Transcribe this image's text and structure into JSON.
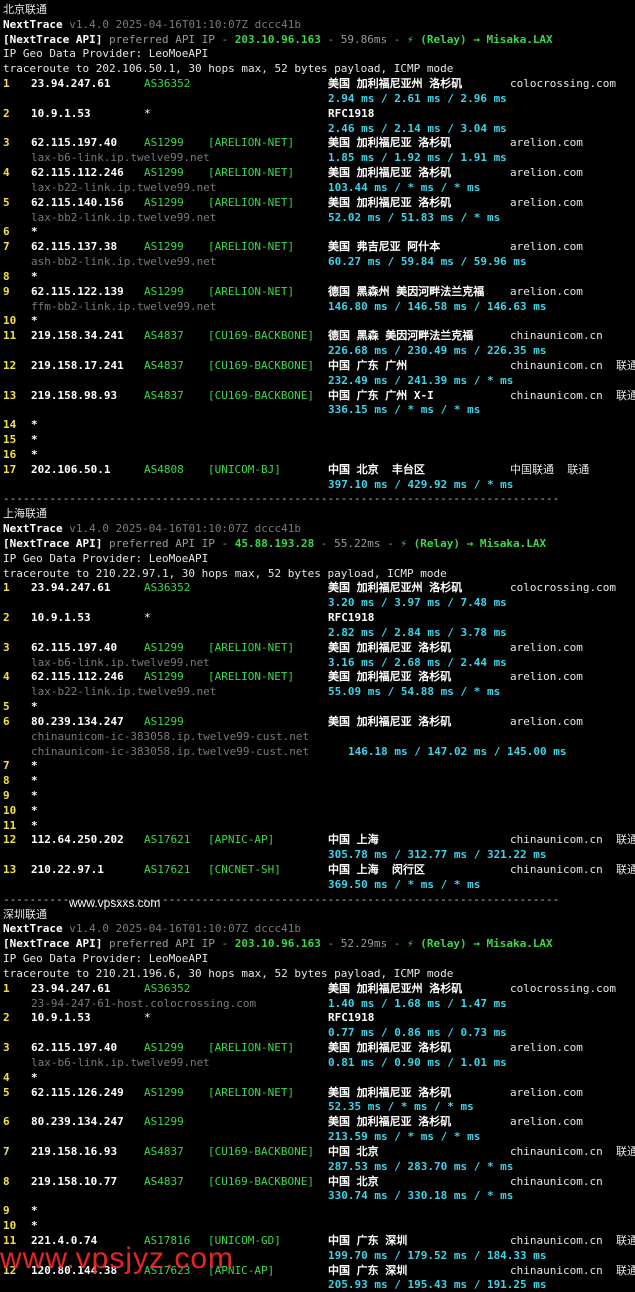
{
  "blocks": [
    {
      "title": "北京联通",
      "version_line": {
        "prog": "NextTrace",
        "ver": "v1.4.0 2025-04-16T01:10:07Z dccc41b"
      },
      "api_line": {
        "tag": "[NextTrace API]",
        "text": " preferred API IP - ",
        "ip": "203.10.96.163",
        "ms": " - 59.86ms - ",
        "relay": "⚡ (Relay) → Misaka.LAX"
      },
      "geo_line": "IP Geo Data Provider: LeoMoeAPI",
      "trace_line": "traceroute to 202.106.50.1, 30 hops max, 52 bytes payload, ICMP mode",
      "hops": [
        {
          "n": "1",
          "ip": "23.94.247.61",
          "as": "AS36352",
          "tag": "",
          "geo": "美国 加利福尼亚州 洛杉矶",
          "dom": "colocrossing.com",
          "rtt": "2.94 ms / 2.61 ms / 2.96 ms"
        },
        {
          "n": "2",
          "ip": "10.9.1.53",
          "as": "*",
          "tag": "",
          "geo": "RFC1918",
          "dom": "",
          "rtt": "2.46 ms / 2.14 ms / 3.04 ms"
        },
        {
          "n": "3",
          "ip": "62.115.197.40",
          "as": "AS1299",
          "tag": "[ARELION-NET]",
          "geo": "美国 加利福尼亚 洛杉矶",
          "dom": "arelion.com",
          "host": "lax-b6-link.ip.twelve99.net",
          "rtt": "1.85 ms / 1.92 ms / 1.91 ms"
        },
        {
          "n": "4",
          "ip": "62.115.112.246",
          "as": "AS1299",
          "tag": "[ARELION-NET]",
          "geo": "美国 加利福尼亚 洛杉矶",
          "dom": "arelion.com",
          "host": "lax-b22-link.ip.twelve99.net",
          "rtt": "103.44 ms / * ms / * ms"
        },
        {
          "n": "5",
          "ip": "62.115.140.156",
          "as": "AS1299",
          "tag": "[ARELION-NET]",
          "geo": "美国 加利福尼亚 洛杉矶",
          "dom": "arelion.com",
          "host": "lax-bb2-link.ip.twelve99.net",
          "rtt": "52.02 ms / 51.83 ms / * ms"
        },
        {
          "n": "6",
          "star": true
        },
        {
          "n": "7",
          "ip": "62.115.137.38",
          "as": "AS1299",
          "tag": "[ARELION-NET]",
          "geo": "美国 弗吉尼亚 阿什本",
          "dom": "arelion.com",
          "host": "ash-bb2-link.ip.twelve99.net",
          "rtt": "60.27 ms / 59.84 ms / 59.96 ms"
        },
        {
          "n": "8",
          "star": true
        },
        {
          "n": "9",
          "ip": "62.115.122.139",
          "as": "AS1299",
          "tag": "[ARELION-NET]",
          "geo": "德国 黑森州 美因河畔法兰克福",
          "dom": "arelion.com",
          "host": "ffm-bb2-link.ip.twelve99.net",
          "rtt": "146.80 ms / 146.58 ms / 146.63 ms"
        },
        {
          "n": "10",
          "star": true
        },
        {
          "n": "11",
          "ip": "219.158.34.241",
          "as": "AS4837",
          "tag": "[CU169-BACKBONE]",
          "geo": "德国 黑森 美因河畔法兰克福",
          "dom": "chinaunicom.cn",
          "rtt": "226.68 ms / 230.49 ms / 226.35 ms"
        },
        {
          "n": "12",
          "ip": "219.158.17.241",
          "as": "AS4837",
          "tag": "[CU169-BACKBONE]",
          "geo": "中国 广东 广州",
          "dom": "chinaunicom.cn  联通",
          "rtt": "232.49 ms / 241.39 ms / * ms"
        },
        {
          "n": "13",
          "ip": "219.158.98.93",
          "as": "AS4837",
          "tag": "[CU169-BACKBONE]",
          "geo": "中国 广东 广州 X-I",
          "dom": "chinaunicom.cn  联通",
          "rtt": "336.15 ms / * ms / * ms"
        },
        {
          "n": "14",
          "star": true
        },
        {
          "n": "15",
          "star": true
        },
        {
          "n": "16",
          "star": true
        },
        {
          "n": "17",
          "ip": "202.106.50.1",
          "as": "AS4808",
          "tag": "[UNICOM-BJ]",
          "geo": "中国 北京  丰台区",
          "dom": "中国联通  联通",
          "rtt": "397.10 ms / 429.92 ms / * ms"
        }
      ]
    },
    {
      "title": "上海联通",
      "version_line": {
        "prog": "NextTrace",
        "ver": "v1.4.0 2025-04-16T01:10:07Z dccc41b"
      },
      "api_line": {
        "tag": "[NextTrace API]",
        "text": " preferred API IP - ",
        "ip": "45.88.193.28",
        "ms": " - 55.22ms - ",
        "relay": "⚡ (Relay) → Misaka.LAX"
      },
      "geo_line": "IP Geo Data Provider: LeoMoeAPI",
      "trace_line": "traceroute to 210.22.97.1, 30 hops max, 52 bytes payload, ICMP mode",
      "hops": [
        {
          "n": "1",
          "ip": "23.94.247.61",
          "as": "AS36352",
          "tag": "",
          "geo": "美国 加利福尼亚州 洛杉矶",
          "dom": "colocrossing.com",
          "rtt": "3.20 ms / 3.97 ms / 7.48 ms"
        },
        {
          "n": "2",
          "ip": "10.9.1.53",
          "as": "*",
          "tag": "",
          "geo": "RFC1918",
          "dom": "",
          "rtt": "2.82 ms / 2.84 ms / 3.78 ms"
        },
        {
          "n": "3",
          "ip": "62.115.197.40",
          "as": "AS1299",
          "tag": "[ARELION-NET]",
          "geo": "美国 加利福尼亚 洛杉矶",
          "dom": "arelion.com",
          "host": "lax-b6-link.ip.twelve99.net",
          "rtt": "3.16 ms / 2.68 ms / 2.44 ms"
        },
        {
          "n": "4",
          "ip": "62.115.112.246",
          "as": "AS1299",
          "tag": "[ARELION-NET]",
          "geo": "美国 加利福尼亚 洛杉矶",
          "dom": "arelion.com",
          "host": "lax-b22-link.ip.twelve99.net",
          "rtt": "55.09 ms / 54.88 ms / * ms"
        },
        {
          "n": "5",
          "star": true
        },
        {
          "n": "6",
          "ip": "80.239.134.247",
          "as": "AS1299",
          "tag": "",
          "geo": "美国 加利福尼亚 洛杉矶",
          "dom": "arelion.com",
          "host": "chinaunicom-ic-383058.ip.twelve99-cust.net",
          "rtt_inline": "146.18 ms / 147.02 ms / 145.00 ms"
        },
        {
          "n": "7",
          "star": true
        },
        {
          "n": "8",
          "star": true
        },
        {
          "n": "9",
          "star": true
        },
        {
          "n": "10",
          "star": true
        },
        {
          "n": "11",
          "star": true
        },
        {
          "n": "12",
          "ip": "112.64.250.202",
          "as": "AS17621",
          "tag": "[APNIC-AP]",
          "geo": "中国 上海",
          "dom": "chinaunicom.cn  联通",
          "rtt": "305.78 ms / 312.77 ms / 321.22 ms"
        },
        {
          "n": "13",
          "ip": "210.22.97.1",
          "as": "AS17621",
          "tag": "[CNCNET-SH]",
          "geo": "中国 上海  闵行区",
          "dom": "chinaunicom.cn  联通",
          "rtt": "369.50 ms / * ms / * ms"
        }
      ]
    },
    {
      "title": "深圳联通",
      "watermark": "www.vpsxxs.com",
      "version_line": {
        "prog": "NextTrace",
        "ver": "v1.4.0 2025-04-16T01:10:07Z dccc41b"
      },
      "api_line": {
        "tag": "[NextTrace API]",
        "text": " preferred API IP - ",
        "ip": "203.10.96.163",
        "ms": " - 52.29ms - ",
        "relay": "⚡ (Relay) → Misaka.LAX"
      },
      "geo_line": "IP Geo Data Provider: LeoMoeAPI",
      "trace_line": "traceroute to 210.21.196.6, 30 hops max, 52 bytes payload, ICMP mode",
      "hops": [
        {
          "n": "1",
          "ip": "23.94.247.61",
          "as": "AS36352",
          "tag": "",
          "geo": "美国 加利福尼亚州 洛杉矶",
          "dom": "colocrossing.com",
          "host": "23-94-247-61-host.colocrossing.com",
          "rtt": "1.40 ms / 1.68 ms / 1.47 ms"
        },
        {
          "n": "2",
          "ip": "10.9.1.53",
          "as": "*",
          "tag": "",
          "geo": "RFC1918",
          "dom": "",
          "rtt": "0.77 ms / 0.86 ms / 0.73 ms"
        },
        {
          "n": "3",
          "ip": "62.115.197.40",
          "as": "AS1299",
          "tag": "[ARELION-NET]",
          "geo": "美国 加利福尼亚 洛杉矶",
          "dom": "arelion.com",
          "host": "lax-b6-link.ip.twelve99.net",
          "rtt": "0.81 ms / 0.90 ms / 1.01 ms"
        },
        {
          "n": "4",
          "star": true
        },
        {
          "n": "5",
          "ip": "62.115.126.249",
          "as": "AS1299",
          "tag": "[ARELION-NET]",
          "geo": "美国 加利福尼亚 洛杉矶",
          "dom": "arelion.com",
          "rtt": "52.35 ms / * ms / * ms"
        },
        {
          "n": "6",
          "ip": "80.239.134.247",
          "as": "AS1299",
          "tag": "",
          "geo": "美国 加利福尼亚 洛杉矶",
          "dom": "arelion.com",
          "rtt": "213.59 ms / * ms / * ms"
        },
        {
          "n": "7",
          "ip": "219.158.16.93",
          "as": "AS4837",
          "tag": "[CU169-BACKBONE]",
          "geo": "中国 北京",
          "dom": "chinaunicom.cn  联通",
          "rtt": "287.53 ms / 283.70 ms / * ms"
        },
        {
          "n": "8",
          "ip": "219.158.10.77",
          "as": "AS4837",
          "tag": "[CU169-BACKBONE]",
          "geo": "中国 北京",
          "dom": "chinaunicom.cn",
          "rtt": "330.74 ms / 330.18 ms / * ms"
        },
        {
          "n": "9",
          "star": true
        },
        {
          "n": "10",
          "star": true
        },
        {
          "n": "11",
          "ip": "221.4.0.74",
          "as": "AS17816",
          "tag": "[UNICOM-GD]",
          "geo": "中国 广东 深圳",
          "dom": "chinaunicom.cn  联通",
          "rtt": "199.70 ms / 179.52 ms / 184.33 ms"
        },
        {
          "n": "12",
          "ip": "120.80.144.38",
          "as": "AS17623",
          "tag": "[APNIC-AP]",
          "geo": "中国 广东 深圳",
          "dom": "chinaunicom.cn  联通",
          "rtt": "205.93 ms / 195.43 ms / 191.25 ms"
        }
      ]
    }
  ],
  "separator": "------------------------------------------------------------------------------------",
  "watermark_bottom": "www.vpsjyz.com"
}
